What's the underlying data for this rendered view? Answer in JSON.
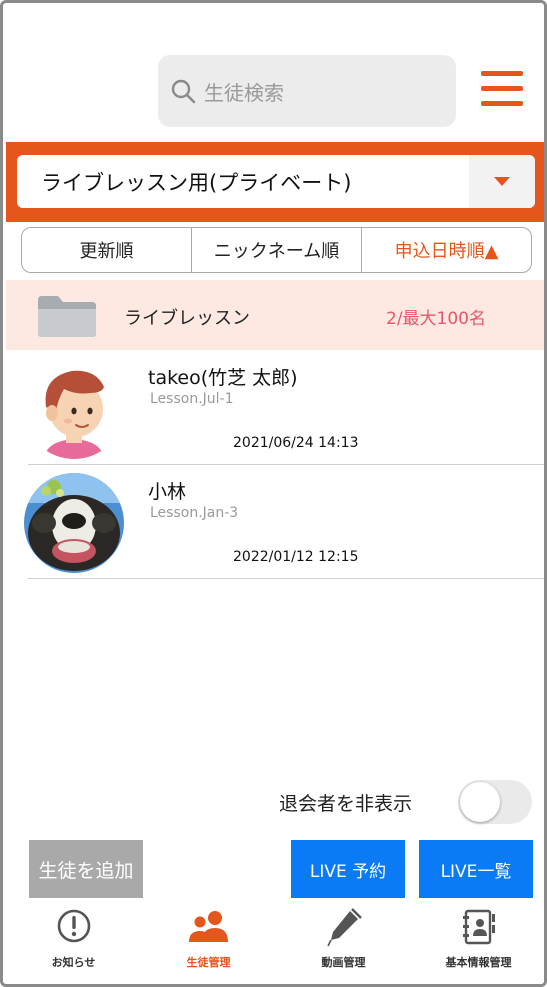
{
  "header": {
    "search_placeholder": "生徒検索",
    "menu_icon": "hamburger-menu-icon"
  },
  "class_select": {
    "selected": "ライブレッスン用(プライベート)"
  },
  "sort": {
    "options": [
      "更新順",
      "ニックネーム順",
      "申込日時順▲"
    ],
    "active_index": 2
  },
  "folder": {
    "name": "ライブレッスン",
    "count": "2/最大100名"
  },
  "students": [
    {
      "name": "takeo(竹芝 太郎)",
      "lesson": "Lesson.Jul-1",
      "date": "2021/06/24 14:13"
    },
    {
      "name": "小林",
      "lesson": "Lesson.Jan-3",
      "date": "2022/01/12 12:15"
    }
  ],
  "hide_withdrawn": {
    "label": "退会者を非表示",
    "on": false
  },
  "actions": {
    "add_student": "生徒を追加",
    "live_reservation": "LIVE 予約",
    "live_list": "LIVE一覧"
  },
  "tabs": [
    {
      "label": "お知らせ",
      "icon": "exclamation-circle-icon"
    },
    {
      "label": "生徒管理",
      "icon": "users-icon"
    },
    {
      "label": "動画管理",
      "icon": "pen-icon"
    },
    {
      "label": "基本情報管理",
      "icon": "contacts-book-icon"
    }
  ],
  "colors": {
    "accent": "#e4561c",
    "live_blue": "#0a7af5",
    "count_pink": "#e8556b"
  }
}
